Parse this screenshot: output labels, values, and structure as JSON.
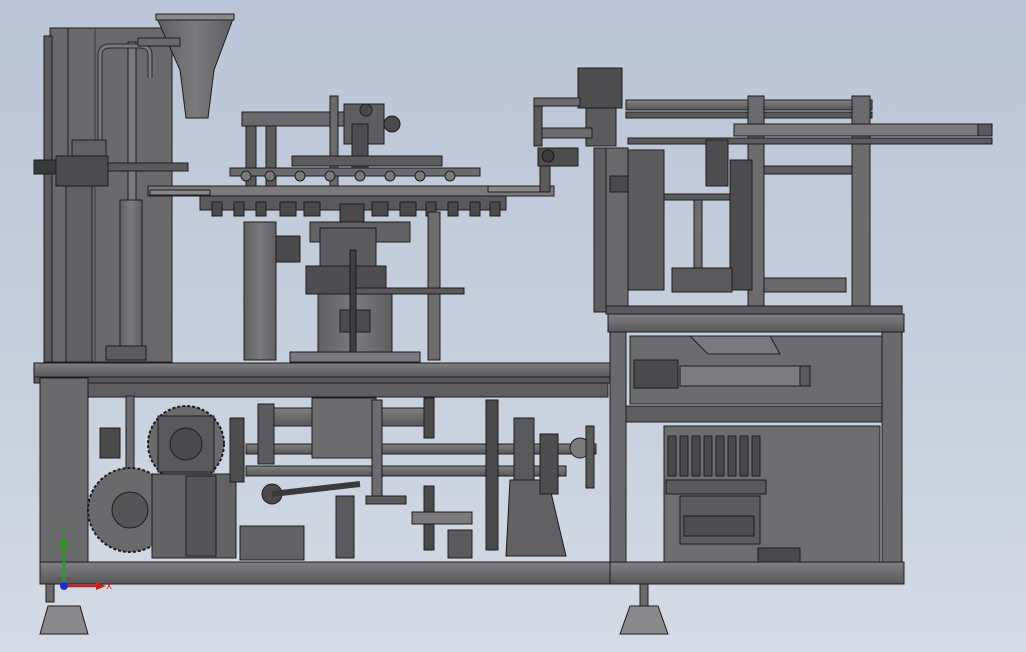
{
  "viewport": {
    "background_top": "#b9c4d6",
    "background_bottom": "#d4dbe6"
  },
  "model": {
    "body_color": "#6e6e70",
    "edge_color": "#1e1e20",
    "highlight_color": "#8a8a8c"
  },
  "triad": {
    "y_label": "Y",
    "x_label": "X",
    "y_color": "#1fa01f",
    "x_color": "#d01f1f",
    "z_color": "#2030d0"
  }
}
